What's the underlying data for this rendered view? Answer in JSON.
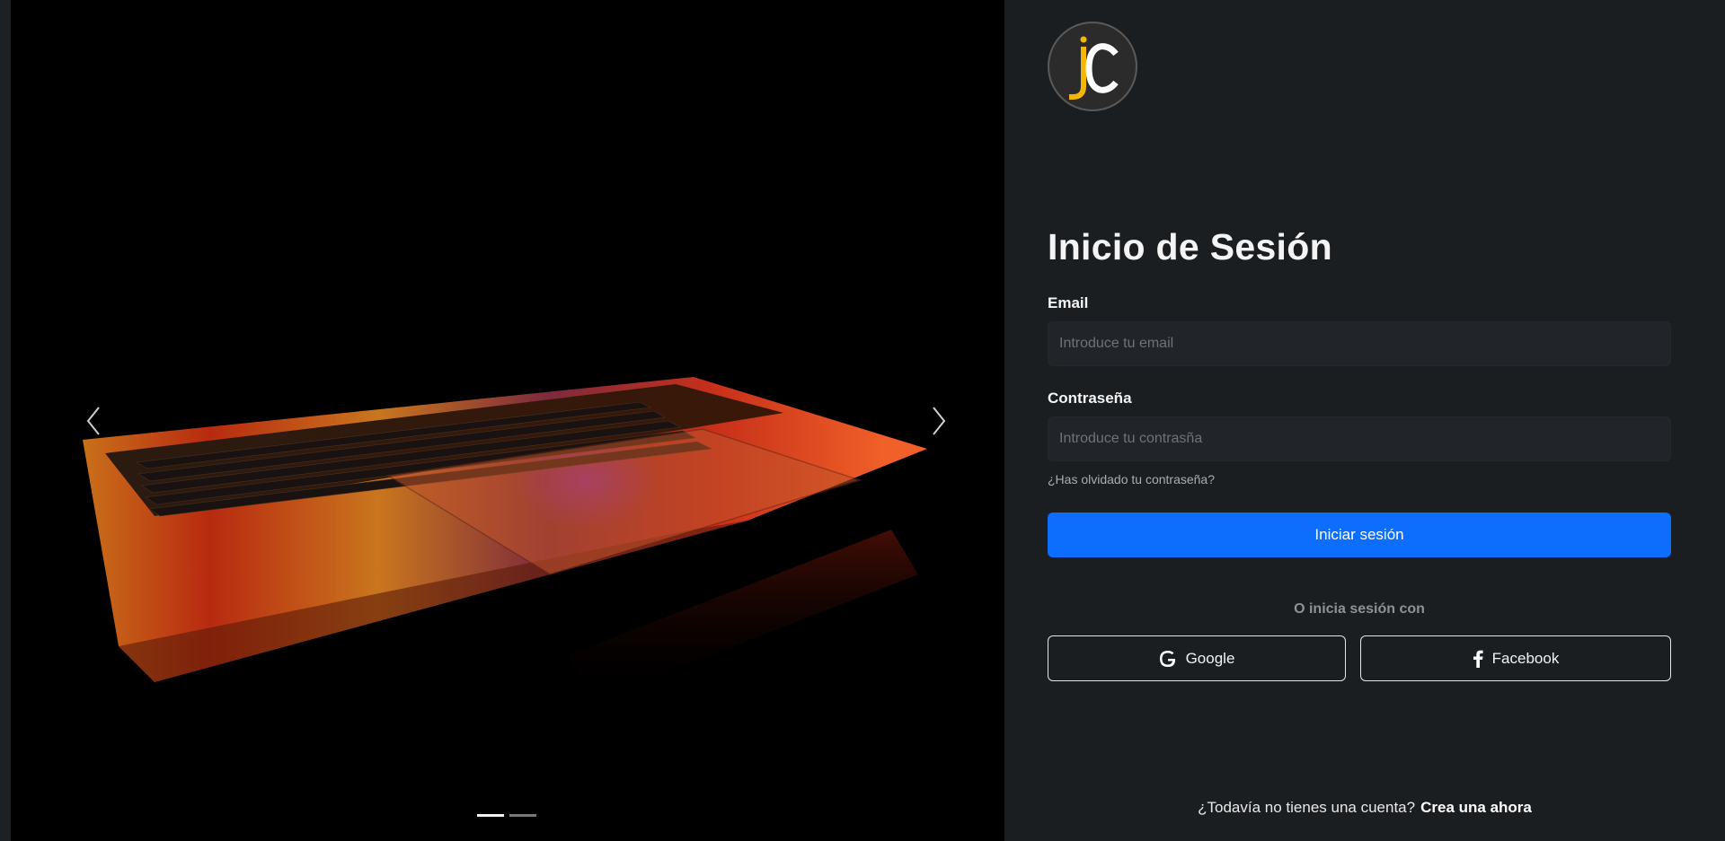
{
  "carousel": {
    "prev_icon": "chevron-left-icon",
    "next_icon": "chevron-right-icon",
    "slides": 2,
    "active_slide": 1
  },
  "logo": {
    "text": "jc",
    "colors": {
      "j": "#f5b800",
      "c": "#ffffff"
    }
  },
  "login": {
    "title": "Inicio de Sesión",
    "email_label": "Email",
    "email_placeholder": "Introduce tu email",
    "password_label": "Contraseña",
    "password_placeholder": "Introduce tu contrasña",
    "forgot_link": "¿Has olvidado tu contraseña?",
    "submit_label": "Iniciar sesión",
    "divider": "O inicia sesión con",
    "google_label": "Google",
    "google_icon": "google-icon",
    "facebook_label": "Facebook",
    "facebook_icon": "facebook-icon",
    "signup_prompt": "¿Todavía no tienes una cuenta?",
    "signup_link": "Crea una ahora"
  },
  "colors": {
    "accent": "#0d6efd",
    "panel_bg": "#1b1e21",
    "input_bg": "#212529"
  }
}
